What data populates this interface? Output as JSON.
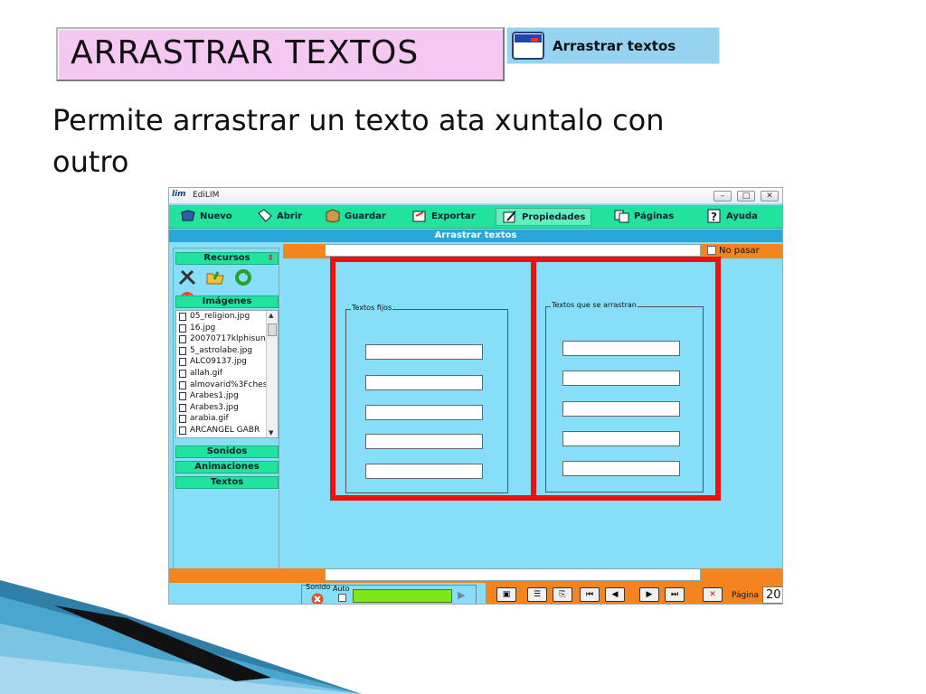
{
  "slide": {
    "title": "ARRASTRAR TEXTOS",
    "tag_label": "Arrastrar textos",
    "subtitle": "Permite arrastrar un texto ata xuntalo con outro"
  },
  "app": {
    "logo": "lim",
    "window_title": "EdiLIM",
    "menu": [
      {
        "label": "Nuevo",
        "icon": "book-icon"
      },
      {
        "label": "Abrir",
        "icon": "open-icon"
      },
      {
        "label": "Guardar",
        "icon": "box-icon"
      },
      {
        "label": "Exportar",
        "icon": "export-icon"
      },
      {
        "label": "Propiedades",
        "icon": "properties-icon"
      },
      {
        "label": "Páginas",
        "icon": "pages-icon"
      },
      {
        "label": "Ayuda",
        "icon": "help-icon"
      }
    ],
    "section_title": "Arrastrar textos",
    "no_pasar_label": "No pasar",
    "sidebar": {
      "recursos_label": "Recursos",
      "imagenes_label": "Imágenes",
      "files": [
        "05_religion.jpg",
        "16.jpg",
        "20070717klphisuni_",
        "5_astrolabe.jpg",
        "ALC09137.jpg",
        "allah.gif",
        "almovarid%3Fchess",
        "Arabes1.jpg",
        "Arabes3.jpg",
        "arabia.gif",
        "ARCANGEL GABR"
      ],
      "sonidos_label": "Sonidos",
      "animaciones_label": "Animaciones",
      "textos_label": "Textos"
    },
    "editor": {
      "left_group_label": "Textos fijos",
      "right_group_label": "Textos que se arrastran"
    },
    "bottom": {
      "sonido_label": "Sonido",
      "auto_label": "Auto",
      "pagina_label": "Página",
      "page_number": "20"
    }
  },
  "colors": {
    "title_box": "#f5c8f2",
    "tag_box": "#96d3f0",
    "app_background": "#86def8",
    "menu_green": "#21e39e",
    "section_blue": "#2aa6d9",
    "accent_orange": "#f5831e",
    "highlight_red": "#ee1111"
  }
}
